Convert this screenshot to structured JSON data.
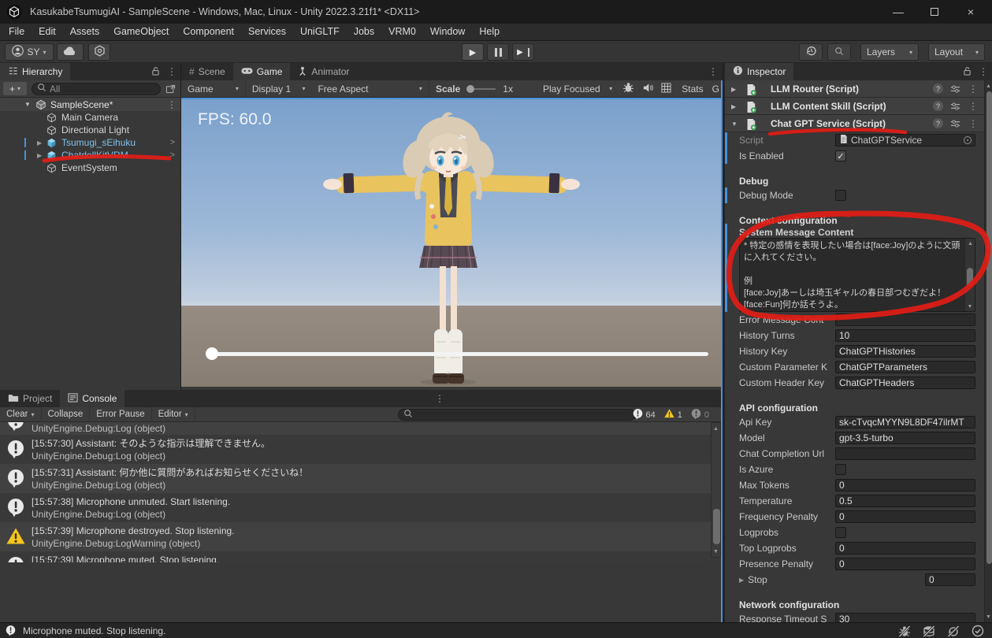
{
  "window": {
    "title": "KasukabeTsumugiAI - SampleScene - Windows, Mac, Linux - Unity 2022.3.21f1* <DX11>",
    "status": "Microphone muted. Stop listening."
  },
  "icons": {
    "caret_down": "▾",
    "kebab": "⋮",
    "plus": "+",
    "foldout_open": "▼",
    "foldout_closed": "▶",
    "chevron_right": ">",
    "minimize": "—",
    "close": "×",
    "check": "✓",
    "play": "▶",
    "scene_hash": "#"
  },
  "menu": {
    "items": [
      "File",
      "Edit",
      "Assets",
      "GameObject",
      "Component",
      "Services",
      "UniGLTF",
      "Jobs",
      "VRM0",
      "Window",
      "Help"
    ]
  },
  "toolbar": {
    "account": "SY",
    "layers": "Layers",
    "layout": "Layout"
  },
  "hierarchy": {
    "title": "Hierarchy",
    "search": "All",
    "scene": {
      "name": "SampleScene*"
    },
    "items": [
      {
        "name": "Main Camera",
        "type": "object"
      },
      {
        "name": "Directional Light",
        "type": "object"
      },
      {
        "name": "Tsumugi_sEihuku",
        "type": "prefab",
        "expandable": true
      },
      {
        "name": "ChatdollKitVRM",
        "type": "prefab",
        "expandable": true,
        "annotated": true
      },
      {
        "name": "EventSystem",
        "type": "object"
      }
    ]
  },
  "game_view": {
    "tabs": [
      "Scene",
      "Game",
      "Animator"
    ],
    "active_tab": "Game",
    "toolbar": {
      "display_target": "Game",
      "display": "Display 1",
      "aspect": "Free Aspect",
      "scale_label": "Scale",
      "scale_value": "1x",
      "play_focused": "Play Focused",
      "stats": "Stats",
      "gizmos": "G"
    },
    "fps": "FPS: 60.0"
  },
  "console": {
    "tabs": [
      "Project",
      "Console"
    ],
    "active_tab": "Console",
    "toolbar": [
      "Clear",
      "Collapse",
      "Error Pause",
      "Editor"
    ],
    "counts": {
      "info": "64",
      "warning": "1",
      "error": "0"
    },
    "entries": [
      {
        "type": "info",
        "line1": "",
        "line2": "UnityEngine.Debug:Log (object)",
        "clip": "top"
      },
      {
        "type": "info",
        "line1": "[15:57:30] Assistant: そのような指示は理解できません。",
        "line2": "UnityEngine.Debug:Log (object)"
      },
      {
        "type": "info",
        "line1": "[15:57:31] Assistant: 何か他に質問があればお知らせくださいね！",
        "line2": "UnityEngine.Debug:Log (object)"
      },
      {
        "type": "info",
        "line1": "[15:57:38] Microphone unmuted. Start listening.",
        "line2": "UnityEngine.Debug:Log (object)"
      },
      {
        "type": "warning",
        "line1": "[15:57:39] Microphone destroyed. Stop listening.",
        "line2": "UnityEngine.Debug:LogWarning (object)"
      },
      {
        "type": "info",
        "line1": "[15:57:39] Microphone muted. Stop listening.",
        "line2": "",
        "clip": "bottom"
      }
    ]
  },
  "inspector": {
    "title": "Inspector",
    "components": [
      {
        "name": "LLM Router (Script)",
        "expanded": false
      },
      {
        "name": "LLM Content Skill (Script)",
        "expanded": false
      },
      {
        "name": "Chat GPT Service (Script)",
        "expanded": true,
        "annotated": true
      }
    ],
    "fields": [
      {
        "kind": "object",
        "label": "Script",
        "value": "ChatGPTService"
      },
      {
        "kind": "checkbox",
        "label": "Is Enabled",
        "checked": true
      },
      {
        "kind": "gap"
      },
      {
        "kind": "header",
        "label": "Debug"
      },
      {
        "kind": "checkbox",
        "label": "Debug Mode",
        "checked": false
      },
      {
        "kind": "gap"
      },
      {
        "kind": "header",
        "label": "Context configuration"
      },
      {
        "kind": "label",
        "label": "System Message Content"
      },
      {
        "kind": "textarea",
        "value": "* 特定の感情を表現したい場合は[face:Joy]のように文頭に入れてください。\n\n例\n[face:Joy]あーしは埼玉ギャルの春日部つむぎだよ！\n[face:Fun]何か話そうよ。"
      },
      {
        "kind": "text",
        "label": "Error Message Cont",
        "value": ""
      },
      {
        "kind": "text",
        "label": "History Turns",
        "value": "10"
      },
      {
        "kind": "text",
        "label": "History Key",
        "value": "ChatGPTHistories"
      },
      {
        "kind": "text",
        "label": "Custom Parameter K",
        "value": "ChatGPTParameters"
      },
      {
        "kind": "text",
        "label": "Custom Header Key",
        "value": "ChatGPTHeaders"
      },
      {
        "kind": "gap"
      },
      {
        "kind": "header",
        "label": "API configuration"
      },
      {
        "kind": "text",
        "label": "Api Key",
        "value": "sk-cTvqcMYYN9L8DF47ilrMT"
      },
      {
        "kind": "text",
        "label": "Model",
        "value": "gpt-3.5-turbo"
      },
      {
        "kind": "text",
        "label": "Chat Completion Url",
        "value": ""
      },
      {
        "kind": "checkbox",
        "label": "Is Azure",
        "checked": false
      },
      {
        "kind": "text",
        "label": "Max Tokens",
        "value": "0"
      },
      {
        "kind": "text",
        "label": "Temperature",
        "value": "0.5"
      },
      {
        "kind": "text",
        "label": "Frequency Penalty",
        "value": "0"
      },
      {
        "kind": "checkbox",
        "label": "Logprobs",
        "checked": false
      },
      {
        "kind": "text",
        "label": "Top Logprobs",
        "value": "0"
      },
      {
        "kind": "text",
        "label": "Presence Penalty",
        "value": "0"
      },
      {
        "kind": "foldout",
        "label": "Stop",
        "value": "0"
      },
      {
        "kind": "gap"
      },
      {
        "kind": "header",
        "label": "Network configuration"
      },
      {
        "kind": "text",
        "label": "Response Timeout S",
        "value": "30"
      }
    ]
  }
}
